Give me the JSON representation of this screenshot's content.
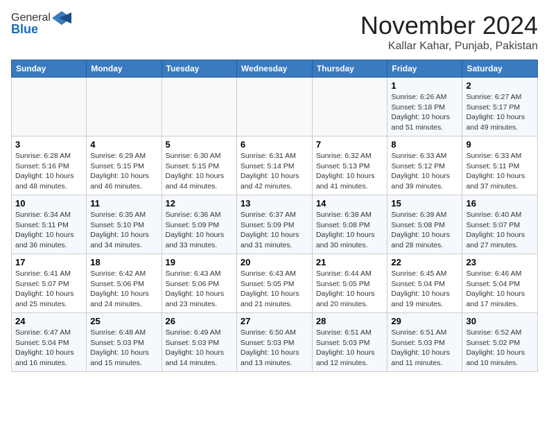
{
  "header": {
    "logo_general": "General",
    "logo_blue": "Blue",
    "month": "November 2024",
    "location": "Kallar Kahar, Punjab, Pakistan"
  },
  "weekdays": [
    "Sunday",
    "Monday",
    "Tuesday",
    "Wednesday",
    "Thursday",
    "Friday",
    "Saturday"
  ],
  "weeks": [
    [
      {
        "day": "",
        "info": ""
      },
      {
        "day": "",
        "info": ""
      },
      {
        "day": "",
        "info": ""
      },
      {
        "day": "",
        "info": ""
      },
      {
        "day": "",
        "info": ""
      },
      {
        "day": "1",
        "info": "Sunrise: 6:26 AM\nSunset: 5:18 PM\nDaylight: 10 hours\nand 51 minutes."
      },
      {
        "day": "2",
        "info": "Sunrise: 6:27 AM\nSunset: 5:17 PM\nDaylight: 10 hours\nand 49 minutes."
      }
    ],
    [
      {
        "day": "3",
        "info": "Sunrise: 6:28 AM\nSunset: 5:16 PM\nDaylight: 10 hours\nand 48 minutes."
      },
      {
        "day": "4",
        "info": "Sunrise: 6:29 AM\nSunset: 5:15 PM\nDaylight: 10 hours\nand 46 minutes."
      },
      {
        "day": "5",
        "info": "Sunrise: 6:30 AM\nSunset: 5:15 PM\nDaylight: 10 hours\nand 44 minutes."
      },
      {
        "day": "6",
        "info": "Sunrise: 6:31 AM\nSunset: 5:14 PM\nDaylight: 10 hours\nand 42 minutes."
      },
      {
        "day": "7",
        "info": "Sunrise: 6:32 AM\nSunset: 5:13 PM\nDaylight: 10 hours\nand 41 minutes."
      },
      {
        "day": "8",
        "info": "Sunrise: 6:33 AM\nSunset: 5:12 PM\nDaylight: 10 hours\nand 39 minutes."
      },
      {
        "day": "9",
        "info": "Sunrise: 6:33 AM\nSunset: 5:11 PM\nDaylight: 10 hours\nand 37 minutes."
      }
    ],
    [
      {
        "day": "10",
        "info": "Sunrise: 6:34 AM\nSunset: 5:11 PM\nDaylight: 10 hours\nand 36 minutes."
      },
      {
        "day": "11",
        "info": "Sunrise: 6:35 AM\nSunset: 5:10 PM\nDaylight: 10 hours\nand 34 minutes."
      },
      {
        "day": "12",
        "info": "Sunrise: 6:36 AM\nSunset: 5:09 PM\nDaylight: 10 hours\nand 33 minutes."
      },
      {
        "day": "13",
        "info": "Sunrise: 6:37 AM\nSunset: 5:09 PM\nDaylight: 10 hours\nand 31 minutes."
      },
      {
        "day": "14",
        "info": "Sunrise: 6:38 AM\nSunset: 5:08 PM\nDaylight: 10 hours\nand 30 minutes."
      },
      {
        "day": "15",
        "info": "Sunrise: 6:39 AM\nSunset: 5:08 PM\nDaylight: 10 hours\nand 28 minutes."
      },
      {
        "day": "16",
        "info": "Sunrise: 6:40 AM\nSunset: 5:07 PM\nDaylight: 10 hours\nand 27 minutes."
      }
    ],
    [
      {
        "day": "17",
        "info": "Sunrise: 6:41 AM\nSunset: 5:07 PM\nDaylight: 10 hours\nand 25 minutes."
      },
      {
        "day": "18",
        "info": "Sunrise: 6:42 AM\nSunset: 5:06 PM\nDaylight: 10 hours\nand 24 minutes."
      },
      {
        "day": "19",
        "info": "Sunrise: 6:43 AM\nSunset: 5:06 PM\nDaylight: 10 hours\nand 23 minutes."
      },
      {
        "day": "20",
        "info": "Sunrise: 6:43 AM\nSunset: 5:05 PM\nDaylight: 10 hours\nand 21 minutes."
      },
      {
        "day": "21",
        "info": "Sunrise: 6:44 AM\nSunset: 5:05 PM\nDaylight: 10 hours\nand 20 minutes."
      },
      {
        "day": "22",
        "info": "Sunrise: 6:45 AM\nSunset: 5:04 PM\nDaylight: 10 hours\nand 19 minutes."
      },
      {
        "day": "23",
        "info": "Sunrise: 6:46 AM\nSunset: 5:04 PM\nDaylight: 10 hours\nand 17 minutes."
      }
    ],
    [
      {
        "day": "24",
        "info": "Sunrise: 6:47 AM\nSunset: 5:04 PM\nDaylight: 10 hours\nand 16 minutes."
      },
      {
        "day": "25",
        "info": "Sunrise: 6:48 AM\nSunset: 5:03 PM\nDaylight: 10 hours\nand 15 minutes."
      },
      {
        "day": "26",
        "info": "Sunrise: 6:49 AM\nSunset: 5:03 PM\nDaylight: 10 hours\nand 14 minutes."
      },
      {
        "day": "27",
        "info": "Sunrise: 6:50 AM\nSunset: 5:03 PM\nDaylight: 10 hours\nand 13 minutes."
      },
      {
        "day": "28",
        "info": "Sunrise: 6:51 AM\nSunset: 5:03 PM\nDaylight: 10 hours\nand 12 minutes."
      },
      {
        "day": "29",
        "info": "Sunrise: 6:51 AM\nSunset: 5:03 PM\nDaylight: 10 hours\nand 11 minutes."
      },
      {
        "day": "30",
        "info": "Sunrise: 6:52 AM\nSunset: 5:02 PM\nDaylight: 10 hours\nand 10 minutes."
      }
    ]
  ]
}
